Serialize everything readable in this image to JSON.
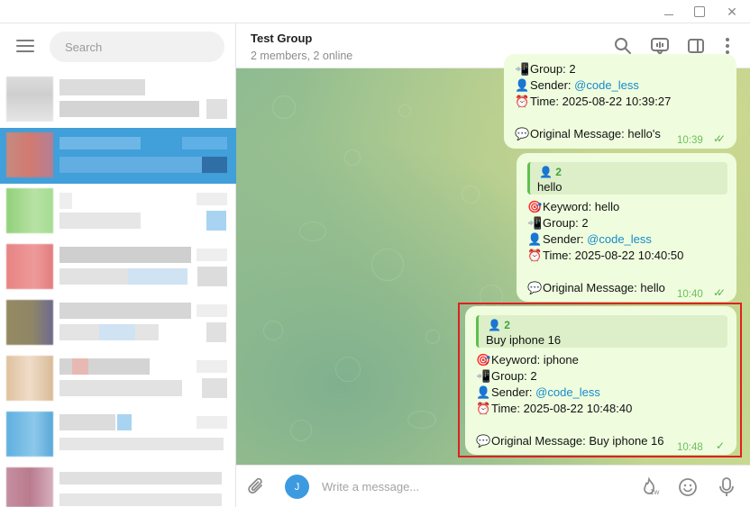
{
  "window": {
    "minimize": "",
    "maximize": "",
    "close": "✕"
  },
  "sidebar": {
    "search_placeholder": "Search",
    "chats": [
      {
        "avatar_color": "#d9d9d9",
        "active": false
      },
      {
        "avatar_color": "#cc7a6e",
        "active": true
      },
      {
        "avatar_color": "#9fd48a",
        "active": false
      },
      {
        "avatar_color": "#e88a8a",
        "active": false
      },
      {
        "avatar_color": "#9a8f6a",
        "active": false
      },
      {
        "avatar_color": "#e0c4a2",
        "active": false
      },
      {
        "avatar_color": "#6cb6e0",
        "active": false
      },
      {
        "avatar_color": "#c08a9a",
        "active": false
      }
    ]
  },
  "header": {
    "title": "Test Group",
    "status": "2 members, 2 online",
    "icons": [
      "search-icon",
      "live-stream-icon",
      "sidebar-toggle-icon",
      "more-vertical-icon"
    ]
  },
  "messages": [
    {
      "group_partial": "Group: 2",
      "sender_label": "Sender: ",
      "sender_mention": "@code_less",
      "time_label": "Time: 2025-08-22 10:39:27",
      "original": "Original Message: hello's",
      "timestamp": "10:39"
    },
    {
      "quote_name": "2",
      "quote_text": "hello",
      "keyword": "Keyword: hello",
      "group": "Group: 2",
      "sender_label": "Sender: ",
      "sender_mention": "@code_less",
      "time_label": "Time: 2025-08-22 10:40:50",
      "original": "Original Message: hello",
      "timestamp": "10:40"
    },
    {
      "quote_name": "2",
      "quote_text": "Buy iphone 16",
      "keyword": "Keyword: iphone",
      "group": "Group: 2",
      "sender_label": "Sender: ",
      "sender_mention": "@code_less",
      "time_label": "Time: 2025-08-22 10:48:40",
      "original": "Original Message: Buy iphone 16",
      "timestamp": "10:48"
    }
  ],
  "composer": {
    "avatar_letter": "J",
    "placeholder": "Write a message...",
    "schedule_badge": "1w"
  },
  "colors": {
    "accent": "#419fd9",
    "bubble": "#effdde",
    "highlight_border": "#e02020",
    "link": "#168acd"
  }
}
